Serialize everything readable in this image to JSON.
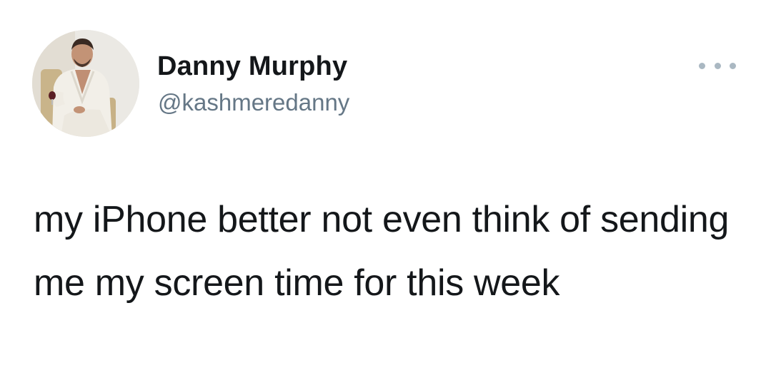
{
  "tweet": {
    "author": {
      "display_name": "Danny Murphy",
      "handle": "@kashmeredanny",
      "avatar_icon": "profile-photo"
    },
    "more_icon": "more-horizontal-icon",
    "text": "my iPhone better not even think of sending me my screen time for this week"
  },
  "colors": {
    "background": "#ffffff",
    "name_text": "#14171a",
    "handle_text": "#657786",
    "body_text": "#14171a",
    "more_dots": "#aab8c2"
  }
}
